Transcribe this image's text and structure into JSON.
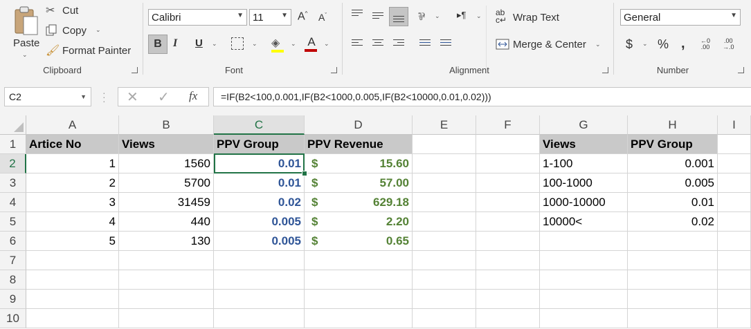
{
  "ribbon": {
    "clipboard": {
      "paste": "Paste",
      "cut": "Cut",
      "copy": "Copy",
      "format_painter": "Format Painter",
      "label": "Clipboard"
    },
    "font": {
      "name": "Calibri",
      "size": "11",
      "bold": "B",
      "italic": "I",
      "underline": "U",
      "font_color_glyph": "A",
      "label": "Font"
    },
    "alignment": {
      "wrap_text": "Wrap Text",
      "merge_center": "Merge & Center",
      "label": "Alignment"
    },
    "number": {
      "format": "General",
      "currency": "$",
      "percent": "%",
      "comma": ",",
      "label": "Number"
    }
  },
  "formula_bar": {
    "name_box": "C2",
    "fx": "fx",
    "formula": "=IF(B2<100,0.001,IF(B2<1000,0.005,IF(B2<10000,0.01,0.02)))"
  },
  "columns": [
    "A",
    "B",
    "C",
    "D",
    "E",
    "F",
    "G",
    "H",
    "I"
  ],
  "rows": [
    "1",
    "2",
    "3",
    "4",
    "5",
    "6",
    "7",
    "8",
    "9",
    "10"
  ],
  "selected_cell": "C2",
  "table1": {
    "headers": [
      "Artice No",
      "Views",
      "PPV Group",
      "PPV Revenue"
    ],
    "rows": [
      {
        "a": "1",
        "b": "1560",
        "c": "0.01",
        "d": "15.60"
      },
      {
        "a": "2",
        "b": "5700",
        "c": "0.01",
        "d": "57.00"
      },
      {
        "a": "3",
        "b": "31459",
        "c": "0.02",
        "d": "629.18"
      },
      {
        "a": "4",
        "b": "440",
        "c": "0.005",
        "d": "2.20"
      },
      {
        "a": "5",
        "b": "130",
        "c": "0.005",
        "d": "0.65"
      }
    ],
    "currency_symbol": "$"
  },
  "table2": {
    "headers": [
      "Views",
      "PPV Group"
    ],
    "rows": [
      {
        "g": "1-100",
        "h": "0.001"
      },
      {
        "g": "100-1000",
        "h": "0.005"
      },
      {
        "g": "1000-10000",
        "h": "0.01"
      },
      {
        "g": "10000<",
        "h": "0.02"
      }
    ]
  },
  "colors": {
    "accent": "#217346",
    "ppv_group_text": "#2f5597",
    "revenue_text": "#548235",
    "header_fill": "#c9c9c9"
  }
}
